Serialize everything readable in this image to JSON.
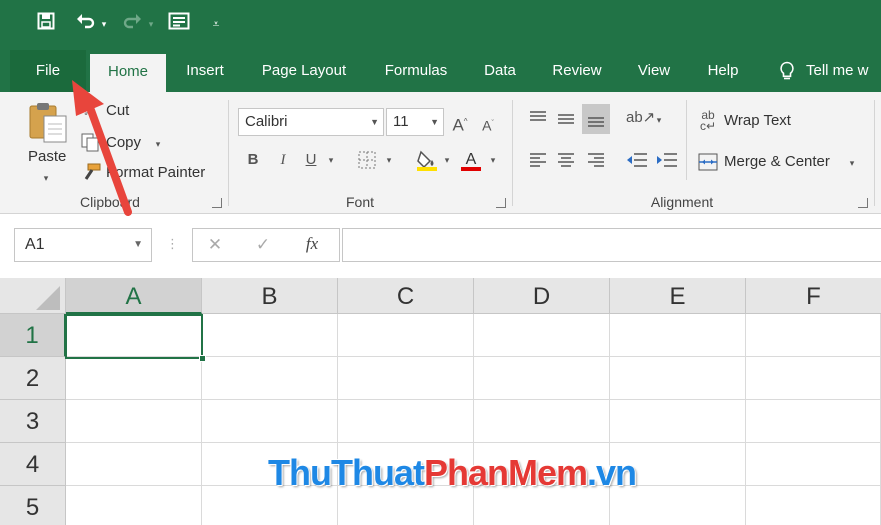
{
  "qat": {
    "save": "save-icon",
    "undo": "undo-icon",
    "redo": "redo-icon",
    "form": "form-icon",
    "customize": "customize-qat-icon"
  },
  "tabs": [
    {
      "label": "File"
    },
    {
      "label": "Home"
    },
    {
      "label": "Insert"
    },
    {
      "label": "Page Layout"
    },
    {
      "label": "Formulas"
    },
    {
      "label": "Data"
    },
    {
      "label": "Review"
    },
    {
      "label": "View"
    },
    {
      "label": "Help"
    },
    {
      "label": "Tell me w"
    }
  ],
  "clipboard": {
    "paste": "Paste",
    "cut": "Cut",
    "copy": "Copy",
    "format_painter": "Format Painter",
    "group": "Clipboard"
  },
  "font": {
    "name": "Calibri",
    "size": "11",
    "group": "Font",
    "highlight_color": "#ffe000",
    "font_color": "#e00000"
  },
  "alignment": {
    "wrap_text": "Wrap Text",
    "merge_center": "Merge & Center",
    "group": "Alignment"
  },
  "formula_bar": {
    "name_box": "A1",
    "fx": "fx",
    "value": ""
  },
  "grid": {
    "columns": [
      "A",
      "B",
      "C",
      "D",
      "E",
      "F"
    ],
    "rows": [
      "1",
      "2",
      "3",
      "4",
      "5"
    ]
  },
  "watermark": {
    "part1": "ThuThuat",
    "part2": "PhanMem",
    "part3": ".vn"
  },
  "colors": {
    "accent": "#217346",
    "arrow": "#e8453c"
  }
}
